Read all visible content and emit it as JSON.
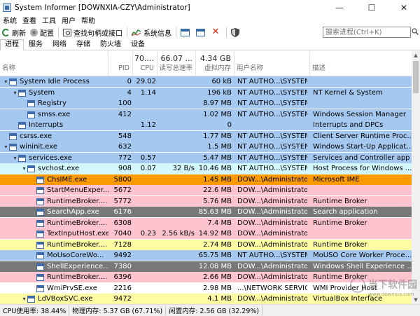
{
  "window": {
    "title": "System Informer [DOWNXIA-CZY\\Administrator]",
    "minimize_glyph": "—",
    "maximize_glyph": "☐",
    "close_glyph": "✕"
  },
  "menu": [
    "系统",
    "查看",
    "工具",
    "用户",
    "帮助"
  ],
  "toolbar": {
    "refresh": "刷新",
    "options": "配置",
    "find_handles": "查找句柄或接口",
    "sysinfo": "系统信息"
  },
  "search": {
    "placeholder": "搜索进程(Ctrl+K)"
  },
  "tabs": [
    "进程",
    "服务",
    "网络",
    "存储",
    "防火墙",
    "设备"
  ],
  "columns": {
    "name": "名称",
    "pid": "PID",
    "cpu": "CPU",
    "cpu_total": "70....",
    "io": "读写总速率",
    "io_total": "66.07 ...",
    "mem": "虚拟内存",
    "mem_total": "4.34 GB",
    "user": "用户名称",
    "desc": "描述"
  },
  "processes": [
    {
      "name": "System Idle Process",
      "depth": 0,
      "exp": "▾",
      "pid": "0",
      "cpu": "29.02",
      "io": "",
      "mem": "60 kB",
      "user": "NT AUTHO...\\SYSTEM",
      "desc": "",
      "bg": "#a5c8f0"
    },
    {
      "name": "System",
      "depth": 1,
      "exp": "▾",
      "pid": "4",
      "cpu": "1.14",
      "io": "",
      "mem": "196 kB",
      "user": "NT AUTHO...\\SYSTEM",
      "desc": "NT Kernel & System",
      "bg": "#a5c8f0"
    },
    {
      "name": "Registry",
      "depth": 2,
      "exp": "",
      "pid": "100",
      "cpu": "",
      "io": "",
      "mem": "8.97 MB",
      "user": "NT AUTHO...\\SYSTEM",
      "desc": "",
      "bg": "#a5c8f0"
    },
    {
      "name": "smss.exe",
      "depth": 2,
      "exp": "",
      "pid": "412",
      "cpu": "",
      "io": "",
      "mem": "1.02 MB",
      "user": "NT AUTHO...\\SYSTEM",
      "desc": "Windows Session Manager",
      "bg": "#a5c8f0"
    },
    {
      "name": "Interrupts",
      "depth": 1,
      "exp": "",
      "pid": "",
      "cpu": "1.12",
      "io": "",
      "mem": "0",
      "user": "",
      "desc": "Interrupts and DPCs",
      "bg": "#a5c8f0"
    },
    {
      "name": "csrss.exe",
      "depth": 0,
      "exp": "",
      "pid": "548",
      "cpu": "",
      "io": "",
      "mem": "1.77 MB",
      "user": "NT AUTHO...\\SYSTEM",
      "desc": "Client Server Runtime Proc...",
      "bg": "#a5c8f0"
    },
    {
      "name": "wininit.exe",
      "depth": 0,
      "exp": "▾",
      "pid": "632",
      "cpu": "",
      "io": "",
      "mem": "1.5 MB",
      "user": "NT AUTHO...\\SYSTEM",
      "desc": "Windows Start-Up Applicat...",
      "bg": "#a5c8f0"
    },
    {
      "name": "services.exe",
      "depth": 1,
      "exp": "▾",
      "pid": "772",
      "cpu": "0.57",
      "io": "",
      "mem": "5.47 MB",
      "user": "NT AUTHO...\\SYSTEM",
      "desc": "Services and Controller app",
      "bg": "#a5c8f0"
    },
    {
      "name": "svchost.exe",
      "depth": 2,
      "exp": "▾",
      "pid": "908",
      "cpu": "0.07",
      "io": "32 B/s",
      "mem": "10.46 MB",
      "user": "NT AUTHO...\\SYSTEM",
      "desc": "Host Process for Windows ...",
      "bg": "#d3f8fc"
    },
    {
      "name": "ChsIME.exe",
      "depth": 3,
      "exp": "",
      "pid": "5800",
      "cpu": "",
      "io": "",
      "mem": "1.45 MB",
      "user": "DOW...\\Administrator",
      "desc": "Microsoft IME",
      "bg": "#fb9a01"
    },
    {
      "name": "StartMenuExper...",
      "depth": 3,
      "exp": "",
      "pid": "5672",
      "cpu": "",
      "io": "",
      "mem": "22.6 MB",
      "user": "DOW...\\Administrator",
      "desc": "",
      "bg": "#fdc4cf"
    },
    {
      "name": "RuntimeBroker....",
      "depth": 3,
      "exp": "",
      "pid": "5772",
      "cpu": "",
      "io": "",
      "mem": "5.76 MB",
      "user": "DOW...\\Administrator",
      "desc": "Runtime Broker",
      "bg": "#fdc4cf"
    },
    {
      "name": "SearchApp.exe",
      "depth": 3,
      "exp": "",
      "pid": "6176",
      "cpu": "",
      "io": "",
      "mem": "85.63 MB",
      "user": "DOW...\\Administrator",
      "desc": "Search application",
      "bg": "#787878",
      "fg": "#ffffff"
    },
    {
      "name": "RuntimeBroker....",
      "depth": 3,
      "exp": "",
      "pid": "6308",
      "cpu": "",
      "io": "",
      "mem": "7.4 MB",
      "user": "DOW...\\Administrator",
      "desc": "Runtime Broker",
      "bg": "#fdc4cf"
    },
    {
      "name": "TextInputHost.exe",
      "depth": 3,
      "exp": "",
      "pid": "7040",
      "cpu": "0.23",
      "io": "2.56 kB/s",
      "mem": "14.92 MB",
      "user": "DOW...\\Administrator",
      "desc": "",
      "bg": "#fdc4cf"
    },
    {
      "name": "RuntimeBroker....",
      "depth": 3,
      "exp": "",
      "pid": "7128",
      "cpu": "",
      "io": "",
      "mem": "2.74 MB",
      "user": "DOW...\\Administrator",
      "desc": "Runtime Broker",
      "bg": "#fefba5"
    },
    {
      "name": "MoUsoCoreWo...",
      "depth": 3,
      "exp": "",
      "pid": "9492",
      "cpu": "",
      "io": "",
      "mem": "65.75 MB",
      "user": "NT AUTHO...\\SYSTEM",
      "desc": "MoUSO Core Worker Proce...",
      "bg": "#a5c8f0"
    },
    {
      "name": "ShellExperience...",
      "depth": 3,
      "exp": "",
      "pid": "7380",
      "cpu": "",
      "io": "",
      "mem": "12.08 MB",
      "user": "DOW...\\Administrator",
      "desc": "Windows Shell Experience ...",
      "bg": "#787878",
      "fg": "#ffffff"
    },
    {
      "name": "RuntimeBroker....",
      "depth": 3,
      "exp": "",
      "pid": "6396",
      "cpu": "",
      "io": "",
      "mem": "2.66 MB",
      "user": "DOW...\\Administrator",
      "desc": "Runtime Broker",
      "bg": "#fdc4cf"
    },
    {
      "name": "WmiPrvSE.exe",
      "depth": 3,
      "exp": "",
      "pid": "2216",
      "cpu": "",
      "io": "",
      "mem": "2.98 MB",
      "user": "...\\NETWORK SERVICE",
      "desc": "WMI Provider Host",
      "bg": "#ffffff"
    },
    {
      "name": "LdVBoxSVC.exe",
      "depth": 2,
      "exp": "▾",
      "pid": "9472",
      "cpu": "",
      "io": "",
      "mem": "4.1 MB",
      "user": "DOW...\\Administrator",
      "desc": "VirtualBox Interface",
      "bg": "#fefba5"
    },
    {
      "name": "",
      "depth": 3,
      "exp": "",
      "pid": "",
      "cpu": "",
      "io": "",
      "mem": "",
      "user": "",
      "desc": "",
      "bg": "#fefba5"
    }
  ],
  "status": {
    "cpu": "CPU使用率: 38.44%",
    "physical": "物理内存: 5.37 GB (67.71%)",
    "free": "闲置内存: 2.56 GB (32.29%)"
  },
  "watermark": {
    "text": "当下软件园",
    "url": "www.downxia.com"
  }
}
